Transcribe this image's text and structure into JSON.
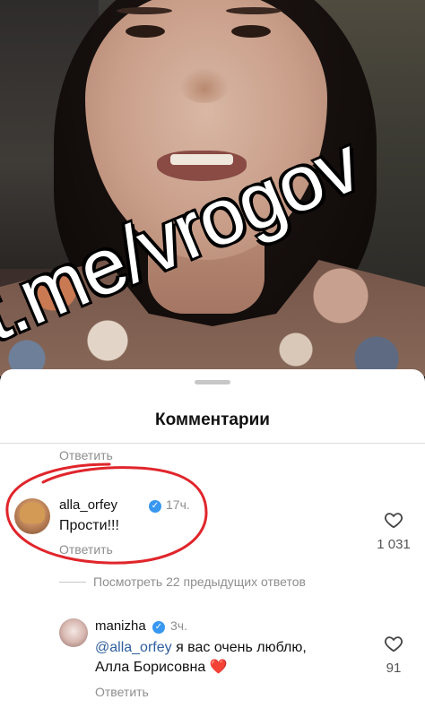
{
  "watermark": "t.me/vrogov",
  "sheet": {
    "title": "Комментарии",
    "reply_label": "Ответить",
    "view_previous": "Посмотреть 22 предыдущих ответов"
  },
  "comments": [
    {
      "username": "alla_orfey",
      "time": "17ч.",
      "text": "Прости!!!",
      "reply": "Ответить",
      "likes": "1 031"
    },
    {
      "username": "manizha",
      "time": "3ч.",
      "mention": "@alla_orfey",
      "text_line1": " я вас очень люблю,",
      "text_line2": "Алла Борисовна",
      "emoji": "❤️",
      "reply": "Ответить",
      "likes": "91"
    }
  ],
  "colors": {
    "verified": "#3897f0",
    "mention": "#2f5f9e",
    "annotation": "#e0252b",
    "heart_emoji": "#e8403a"
  },
  "icons": [
    "heart-icon",
    "verified-icon"
  ]
}
